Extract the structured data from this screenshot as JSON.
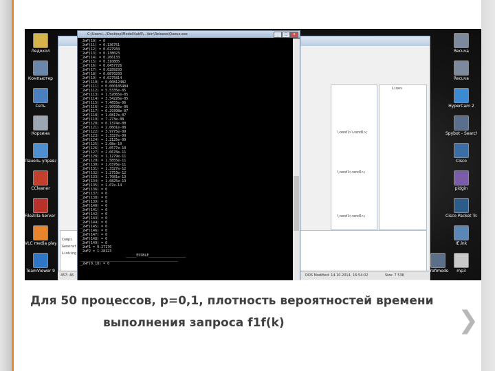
{
  "console": {
    "title": "C:\\Users\\...\\Desktop\\Modeli\\lab5\\...\\bin\\Release\\Queue.exe",
    "lines": [
      "_2мF(10) = 0",
      "_2мF(11) = 0.136751",
      "_2мF(12) = 0.627934",
      "_2мF(13) = 0.138023",
      "_2мF(14) = 0.266133",
      "_2мF(15) = 0.310805",
      "_2мF(16) = 0.0457726",
      "_2мF(17) = 0.0289293",
      "_2мF(18) = 0.0870293",
      "_2мF(19) = 0.0275814",
      "_2мF(110) = 0.00812482",
      "_2мF(111) = 0.000185484",
      "_2мF(112) = 5.5335e-05",
      "_2мF(113) = 1.52065e-05",
      "_2мF(114) = 3.54226e-05",
      "_2мF(115) = 7.4655e-06",
      "_2мF(116) = 2.90936e-06",
      "_2мF(117) = 6.29398e-07",
      "_2мF(118) = 1.0817e-07",
      "_2мF(119) = 7.273e-08",
      "_2мF(120) = 6.1374e-08",
      "_2мF(121) = 2.0601e-08",
      "_2мF(122) = 3.9775e-09",
      "_2мF(123) = 1.3327e-09",
      "_2мF(124) = 1.2125e-09",
      "_2мF(125) = 2.08e-10",
      "_2мF(126) = 1.0577e-10",
      "_2мF(127) = 2.0678e-11",
      "_2мF(128) = 1.1279e-11",
      "_2мF(129) = 1.5855e-11",
      "_2мF(130) = 1.0376e-11",
      "_2мF(131) = 1.3327e-12",
      "_2мF(132) = 1.2753e-12",
      "_2мF(133) = 1.7081e-13",
      "_2мF(134) = 1.0825e-13",
      "_2мF(135) = 1.07e-14",
      "_2мF(136) = 0",
      "_2мF(137) = 0",
      "_2мF(138) = 0",
      "_2мF(139) = 0",
      "_2мF(140) = 0",
      "_2мF(141) = 0",
      "_2мF(142) = 0",
      "_2мF(143) = 0",
      "_2мF(144) = 0",
      "_2мF(145) = 0",
      "_2мF(146) = 0",
      "_2мF(147) = 0",
      "_2мF(148) = 0",
      "_2мF(149) = 0",
      "_2мF1 = 9.27176",
      "_2мF2 = 1.28123",
      "                      _____ESSBLE__________________",
      "_______________________________________________",
      "_2мF(0.18) = 0"
    ]
  },
  "desktop": {
    "left_icons": [
      "Ледокол",
      "Компьютер",
      "Сеть",
      "Корзина",
      "Панель управления",
      "CCleaner",
      "FileZilla Server ...",
      "VLC media player",
      "TeamViewer 9"
    ],
    "right_icons": [
      "Recuva",
      "Recuva",
      "HyperCam 2",
      "Spybot - Search ...",
      "Cisco",
      "pidgin",
      "Cisco Packet Tracer",
      "IE.lnk",
      "mp3"
    ],
    "mid_label": "Profimeds"
  },
  "app": {
    "code_lines": [
      "\\<endl>\\<endl>;",
      "\\<endl><endl>;",
      "\\<endl><endl>;"
    ],
    "lines_label": "Lines",
    "bottom_labels": [
      "Compi",
      "Generat",
      "Linking"
    ],
    "status": {
      "left": "457: 46",
      "mid": "DOS   Modified: 14.10.2014, 16:54:02",
      "right": "Size: 7 536"
    }
  },
  "caption": {
    "line1": "Для 50 процессов,  p=0,1,  плотность вероятностей времени",
    "line2": "выполнения запроса f1f(k)"
  },
  "icons": {
    "next": "chevron-right-icon"
  }
}
